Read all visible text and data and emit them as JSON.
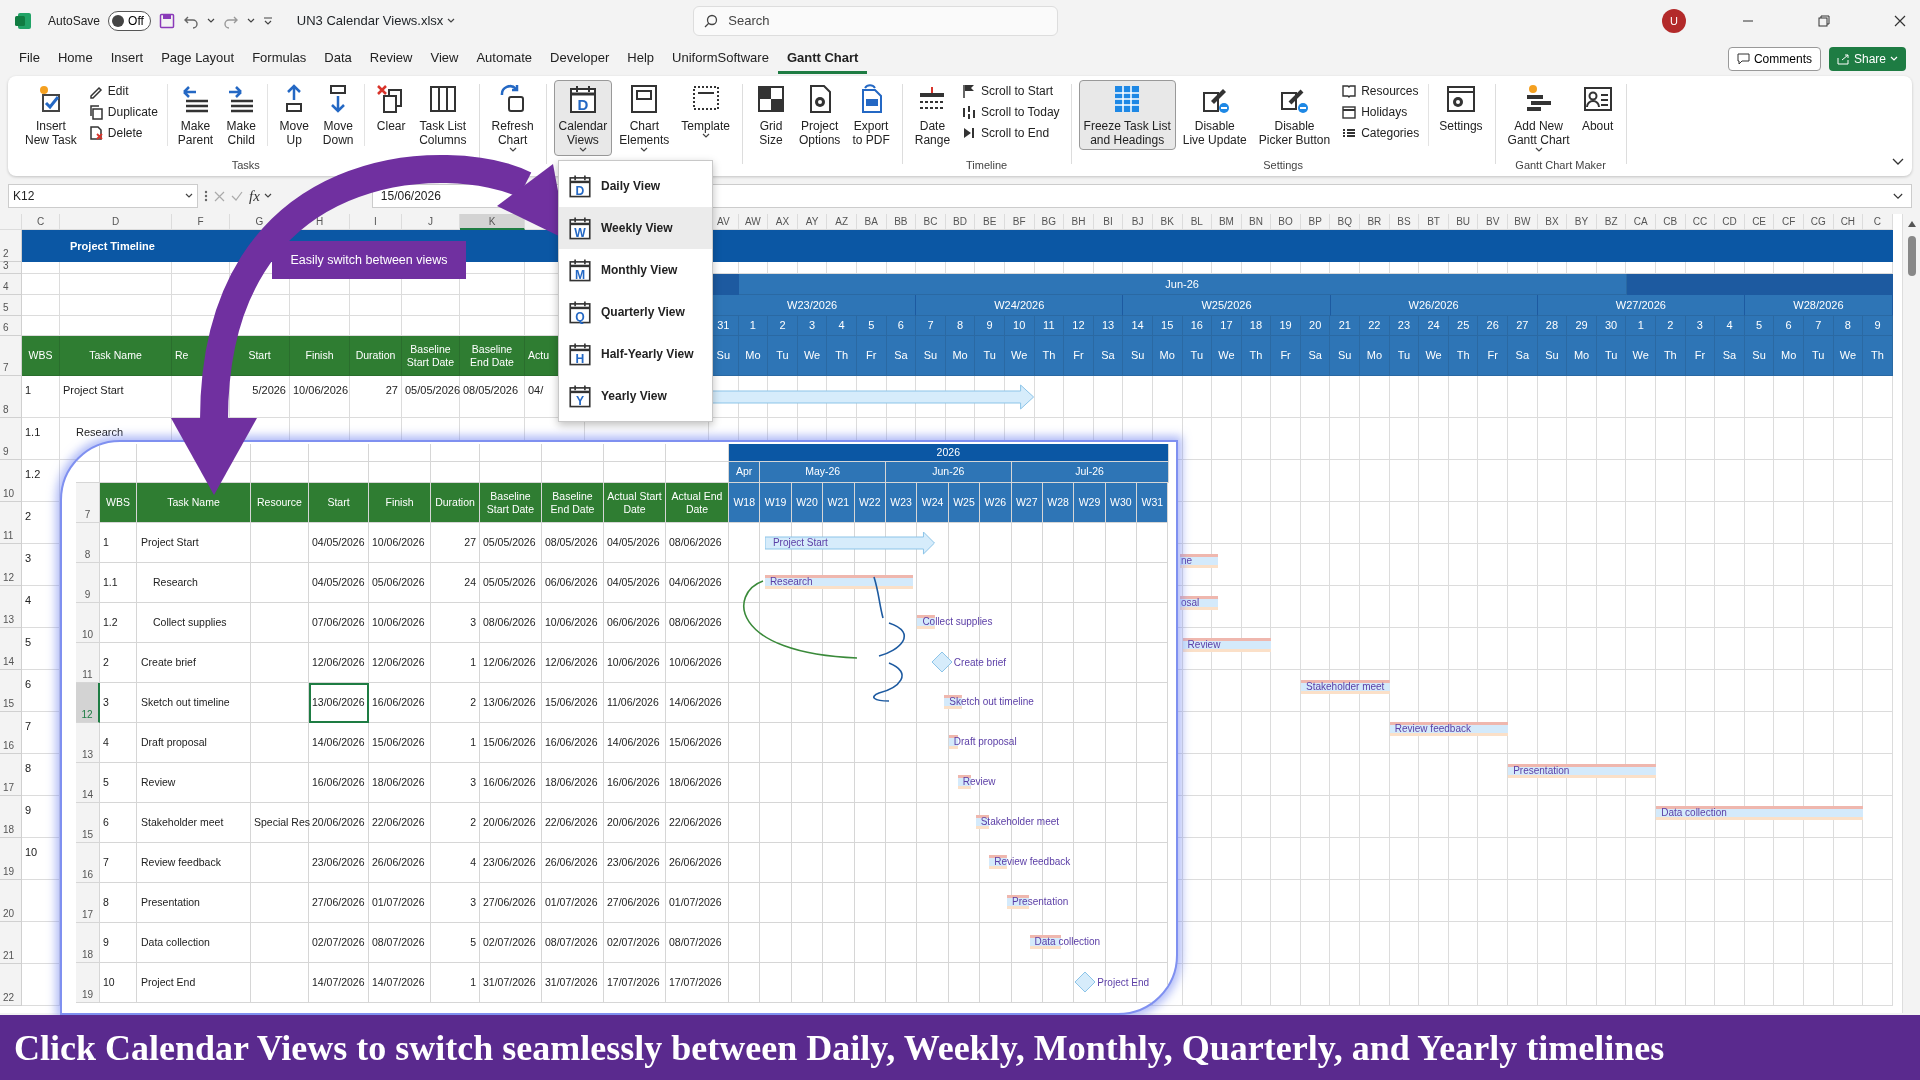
{
  "title_bar": {
    "autosave_label": "AutoSave",
    "autosave_state": "Off",
    "autosave_on": false,
    "file_name": "UN3 Calendar Views.xlsx",
    "search_placeholder": "Search",
    "user_initial": "U"
  },
  "menu": {
    "tabs": [
      {
        "label": "File",
        "selected": false
      },
      {
        "label": "Home",
        "selected": false
      },
      {
        "label": "Insert",
        "selected": false
      },
      {
        "label": "Page Layout",
        "selected": false
      },
      {
        "label": "Formulas",
        "selected": false
      },
      {
        "label": "Data",
        "selected": false
      },
      {
        "label": "Review",
        "selected": false
      },
      {
        "label": "View",
        "selected": false
      },
      {
        "label": "Automate",
        "selected": false
      },
      {
        "label": "Developer",
        "selected": false
      },
      {
        "label": "Help",
        "selected": false
      },
      {
        "label": "UniformSoftware",
        "selected": false
      },
      {
        "label": "Gantt Chart",
        "selected": true
      }
    ],
    "comments": "Comments",
    "share": "Share"
  },
  "ribbon": {
    "groups": [
      {
        "label": "Tasks",
        "items": [
          {
            "kind": "large",
            "lines": [
              "Insert",
              "New Task"
            ],
            "pressed": false,
            "dropdown": false
          },
          {
            "kind": "stack",
            "items": [
              {
                "label": "Edit"
              },
              {
                "label": "Duplicate"
              },
              {
                "label": "Delete"
              }
            ]
          },
          {
            "kind": "separator"
          },
          {
            "kind": "large",
            "lines": [
              "Make",
              "Parent"
            ],
            "pressed": false,
            "dropdown": false
          },
          {
            "kind": "large",
            "lines": [
              "Make",
              "Child"
            ],
            "pressed": false,
            "dropdown": false
          },
          {
            "kind": "separator"
          },
          {
            "kind": "large",
            "lines": [
              "Move",
              "Up"
            ],
            "pressed": false,
            "dropdown": false
          },
          {
            "kind": "large",
            "lines": [
              "Move",
              "Down"
            ],
            "pressed": false,
            "dropdown": false
          },
          {
            "kind": "separator"
          },
          {
            "kind": "large",
            "lines": [
              "Clear"
            ],
            "pressed": false,
            "dropdown": false
          },
          {
            "kind": "large",
            "lines": [
              "Task List",
              "Columns"
            ],
            "pressed": false,
            "dropdown": false
          }
        ]
      },
      {
        "items": [
          {
            "kind": "large",
            "lines": [
              "Refresh",
              "Chart"
            ],
            "pressed": false,
            "dropdown": true
          }
        ]
      },
      {
        "items": [
          {
            "kind": "large",
            "lines": [
              "Calendar",
              "Views"
            ],
            "pressed": true,
            "dropdown": true,
            "icon_letter": "D"
          },
          {
            "kind": "large",
            "lines": [
              "Chart",
              "Elements"
            ],
            "pressed": false,
            "dropdown": true
          },
          {
            "kind": "large",
            "lines": [
              "Template"
            ],
            "pressed": false,
            "dropdown": true
          }
        ]
      },
      {
        "items": [
          {
            "kind": "large",
            "lines": [
              "Grid",
              "Size"
            ],
            "pressed": false,
            "dropdown": false
          },
          {
            "kind": "large",
            "lines": [
              "Project",
              "Options"
            ],
            "pressed": false,
            "dropdown": false
          },
          {
            "kind": "large",
            "lines": [
              "Export",
              "to PDF"
            ],
            "pressed": false,
            "dropdown": false
          }
        ]
      },
      {
        "label": "Timeline",
        "items": [
          {
            "kind": "large",
            "lines": [
              "Date",
              "Range"
            ],
            "pressed": false,
            "dropdown": false
          },
          {
            "kind": "stack",
            "items": [
              {
                "label": "Scroll to Start"
              },
              {
                "label": "Scroll to Today"
              },
              {
                "label": "Scroll to End"
              }
            ]
          }
        ]
      },
      {
        "label": "Settings",
        "items": [
          {
            "kind": "large",
            "lines": [
              "Freeze Task List",
              "and Headings"
            ],
            "pressed": true,
            "dropdown": false
          },
          {
            "kind": "large",
            "lines": [
              "Disable",
              "Live Update"
            ],
            "pressed": false,
            "dropdown": false
          },
          {
            "kind": "large",
            "lines": [
              "Disable",
              "Picker Button"
            ],
            "pressed": false,
            "dropdown": false
          },
          {
            "kind": "stack",
            "items": [
              {
                "label": "Resources"
              },
              {
                "label": "Holidays"
              },
              {
                "label": "Categories"
              }
            ]
          },
          {
            "kind": "separator"
          },
          {
            "kind": "large",
            "lines": [
              "Settings"
            ],
            "pressed": false,
            "dropdown": false
          }
        ]
      },
      {
        "label": "Gantt Chart Maker",
        "items": [
          {
            "kind": "large",
            "lines": [
              "Add New",
              "Gantt Chart"
            ],
            "pressed": false,
            "dropdown": true
          },
          {
            "kind": "large",
            "lines": [
              "About"
            ],
            "pressed": false,
            "dropdown": false
          }
        ]
      }
    ]
  },
  "formula_bar": {
    "name_box": "K12",
    "function_label": "fx",
    "value": "15/06/2026"
  },
  "sheet": {
    "column_letters": [
      {
        "letter": "C",
        "selected": false
      },
      {
        "letter": "D",
        "selected": false
      },
      {
        "letter": "F",
        "selected": false
      },
      {
        "letter": "G",
        "selected": false
      },
      {
        "letter": "H",
        "selected": false
      },
      {
        "letter": "I",
        "selected": false
      },
      {
        "letter": "J",
        "selected": false
      },
      {
        "letter": "K",
        "selected": true
      }
    ],
    "calendar_letters": [
      "AV",
      "AW",
      "AX",
      "AY",
      "AZ",
      "BA",
      "BB",
      "BC",
      "BD",
      "BE",
      "BF",
      "BG",
      "BH",
      "BI",
      "BJ",
      "BK",
      "BL",
      "BM",
      "BN",
      "BO",
      "BP",
      "BQ",
      "BR",
      "BS",
      "BT",
      "BU",
      "BV",
      "BW",
      "BX",
      "BY",
      "BZ",
      "CA",
      "CB",
      "CC",
      "CD",
      "CE",
      "CF",
      "CG",
      "CH",
      "C"
    ],
    "row_numbers": [
      "2",
      "3",
      "4",
      "5",
      "6",
      "7",
      "8",
      "9",
      "10",
      "11",
      "12",
      "13",
      "14",
      "15",
      "16",
      "17",
      "18",
      "19",
      "20",
      "21",
      "22"
    ],
    "title": "Project Timeline",
    "calendar": {
      "months": [
        {
          "days": [
            {
              "date": "31",
              "weekday": "Su"
            }
          ]
        },
        {
          "label": "Jun-26",
          "days": [
            {
              "date": "1",
              "weekday": "Mo"
            },
            {
              "date": "2",
              "weekday": "Tu"
            },
            {
              "date": "3",
              "weekday": "We"
            },
            {
              "date": "4",
              "weekday": "Th"
            },
            {
              "date": "5",
              "weekday": "Fr"
            },
            {
              "date": "6",
              "weekday": "Sa"
            },
            {
              "date": "7",
              "weekday": "Su"
            },
            {
              "date": "8",
              "weekday": "Mo"
            },
            {
              "date": "9",
              "weekday": "Tu"
            },
            {
              "date": "10",
              "weekday": "We"
            },
            {
              "date": "11",
              "weekday": "Th"
            },
            {
              "date": "12",
              "weekday": "Fr"
            },
            {
              "date": "13",
              "weekday": "Sa"
            },
            {
              "date": "14",
              "weekday": "Su"
            },
            {
              "date": "15",
              "weekday": "Mo"
            },
            {
              "date": "16",
              "weekday": "Tu"
            },
            {
              "date": "17",
              "weekday": "We"
            },
            {
              "date": "18",
              "weekday": "Th"
            },
            {
              "date": "19",
              "weekday": "Fr"
            },
            {
              "date": "20",
              "weekday": "Sa"
            },
            {
              "date": "21",
              "weekday": "Su"
            },
            {
              "date": "22",
              "weekday": "Mo"
            },
            {
              "date": "23",
              "weekday": "Tu"
            },
            {
              "date": "24",
              "weekday": "We"
            },
            {
              "date": "25",
              "weekday": "Th"
            },
            {
              "date": "26",
              "weekday": "Fr"
            },
            {
              "date": "27",
              "weekday": "Sa"
            },
            {
              "date": "28",
              "weekday": "Su"
            },
            {
              "date": "29",
              "weekday": "Mo"
            },
            {
              "date": "30",
              "weekday": "Tu"
            }
          ]
        },
        {
          "days": [
            {
              "date": "1",
              "weekday": "We"
            },
            {
              "date": "2",
              "weekday": "Th"
            },
            {
              "date": "3",
              "weekday": "Fr"
            },
            {
              "date": "4",
              "weekday": "Sa"
            },
            {
              "date": "5",
              "weekday": "Su"
            },
            {
              "date": "6",
              "weekday": "Mo"
            },
            {
              "date": "7",
              "weekday": "Tu"
            },
            {
              "date": "8",
              "weekday": "We"
            },
            {
              "date": "9",
              "weekday": "Th"
            }
          ]
        }
      ],
      "weeks": [
        {
          "label": "W23/2026"
        },
        {
          "label": "W24/2026"
        },
        {
          "label": "W25/2026"
        },
        {
          "label": "W26/2026"
        },
        {
          "label": "W27/2026"
        },
        {
          "label": "W28/2026"
        }
      ]
    },
    "header": [
      "WBS",
      "Task Name",
      "Re",
      "Start",
      "Finish",
      "Duration",
      "Baseline Start Date",
      "Baseline End Date",
      "Actu"
    ],
    "rows": [
      {
        "wbs": "1",
        "task": "Project Start",
        "start": "5/2026",
        "finish": "10/06/2026",
        "duration": "27",
        "baseline_start": "05/05/2026",
        "baseline_end": "08/05/2026",
        "actual_start": "04/",
        "bar": {
          "kind": "arrow"
        }
      },
      {
        "wbs": "1.1",
        "task": "Research"
      },
      {
        "wbs": "1.2"
      },
      {
        "wbs": "2"
      },
      {
        "wbs": "3",
        "bar": {
          "kind": "task",
          "label": "ne"
        }
      },
      {
        "wbs": "4",
        "bar": {
          "kind": "task",
          "label": "osal"
        }
      },
      {
        "wbs": "5",
        "bar": {
          "kind": "task",
          "label": "Review"
        }
      },
      {
        "wbs": "6",
        "bar": {
          "kind": "task",
          "label": "Stakeholder meet"
        }
      },
      {
        "wbs": "7",
        "bar": {
          "kind": "task",
          "label": "Review feedback"
        }
      },
      {
        "wbs": "8",
        "bar": {
          "kind": "task",
          "label": "Presentation"
        }
      },
      {
        "wbs": "9",
        "bar": {
          "kind": "task",
          "label": "Data collection"
        }
      },
      {
        "wbs": "10"
      }
    ]
  },
  "views_menu": {
    "items": [
      {
        "label": "Daily View",
        "icon_letter": "D",
        "selected": false
      },
      {
        "label": "Weekly View",
        "icon_letter": "W",
        "selected": true
      },
      {
        "label": "Monthly View",
        "icon_letter": "M",
        "selected": false
      },
      {
        "label": "Quarterly View",
        "icon_letter": "Q",
        "selected": false
      },
      {
        "label": "Half-Yearly View",
        "icon_letter": "H",
        "selected": false
      },
      {
        "label": "Yearly View",
        "icon_letter": "Y",
        "selected": false
      }
    ]
  },
  "callout": "Easily switch between views",
  "inset": {
    "header_row_number": "7",
    "year": "2026",
    "months": [
      {
        "label": "Apr",
        "weeks": [
          "W18"
        ]
      },
      {
        "label": "May-26",
        "weeks": [
          "W19",
          "W20",
          "W21",
          "W22"
        ]
      },
      {
        "label": "Jun-26",
        "weeks": [
          "W23",
          "W24",
          "W25",
          "W26"
        ]
      },
      {
        "label": "Jul-26",
        "weeks": [
          "W27",
          "W28",
          "W29",
          "W30",
          "W31"
        ]
      }
    ],
    "columns": [
      "WBS",
      "Task Name",
      "Resource",
      "Start",
      "Finish",
      "Duration",
      "Baseline Start Date",
      "Baseline End Date",
      "Actual Start Date",
      "Actual End Date"
    ],
    "row_numbers": [
      "8",
      "9",
      "10",
      "11",
      "12",
      "13",
      "14",
      "15",
      "16",
      "17",
      "18",
      "19"
    ],
    "rows": [
      {
        "wbs": "1",
        "task": "Project Start",
        "bar_label": "Project Start",
        "start": "04/05/2026",
        "finish": "10/06/2026",
        "duration": "27",
        "baseline_start": "05/05/2026",
        "baseline_end": "08/05/2026",
        "actual_start": "04/05/2026",
        "actual_end": "08/06/2026",
        "kind": "summary",
        "active_cell": false,
        "children": [
          {
            "wbs": "1.1",
            "task": "Research",
            "bar_label": "Research",
            "start": "04/05/2026",
            "finish": "05/06/2026",
            "duration": "24",
            "baseline_start": "05/05/2026",
            "baseline_end": "06/06/2026",
            "actual_start": "04/05/2026",
            "actual_end": "04/06/2026",
            "kind": "task",
            "active_cell": false
          },
          {
            "wbs": "1.2",
            "task": "Collect supplies",
            "bar_label": "Collect supplies",
            "start": "07/06/2026",
            "finish": "10/06/2026",
            "duration": "3",
            "baseline_start": "08/06/2026",
            "baseline_end": "10/06/2026",
            "actual_start": "06/06/2026",
            "actual_end": "08/06/2026",
            "kind": "task",
            "active_cell": false
          }
        ]
      },
      {
        "wbs": "2",
        "task": "Create brief",
        "bar_label": "Create brief",
        "start": "12/06/2026",
        "finish": "12/06/2026",
        "duration": "1",
        "baseline_start": "12/06/2026",
        "baseline_end": "12/06/2026",
        "actual_start": "10/06/2026",
        "actual_end": "10/06/2026",
        "kind": "milestone",
        "active_cell": false
      },
      {
        "wbs": "3",
        "task": "Sketch out timeline",
        "bar_label": "Sketch out timeline",
        "start": "13/06/2026",
        "finish": "16/06/2026",
        "duration": "2",
        "baseline_start": "13/06/2026",
        "baseline_end": "15/06/2026",
        "actual_start": "11/06/2026",
        "actual_end": "14/06/2026",
        "kind": "task",
        "active_cell": true
      },
      {
        "wbs": "4",
        "task": "Draft proposal",
        "bar_label": "Draft proposal",
        "start": "14/06/2026",
        "finish": "15/06/2026",
        "duration": "1",
        "baseline_start": "15/06/2026",
        "baseline_end": "16/06/2026",
        "actual_start": "14/06/2026",
        "actual_end": "15/06/2026",
        "kind": "task",
        "active_cell": false
      },
      {
        "wbs": "5",
        "task": "Review",
        "bar_label": "Review",
        "start": "16/06/2026",
        "finish": "18/06/2026",
        "duration": "3",
        "baseline_start": "16/06/2026",
        "baseline_end": "18/06/2026",
        "actual_start": "16/06/2026",
        "actual_end": "18/06/2026",
        "kind": "task",
        "active_cell": false
      },
      {
        "wbs": "6",
        "task": "Stakeholder meet",
        "bar_label": "Stakeholder meet",
        "resource": "Special Res",
        "start": "20/06/2026",
        "finish": "22/06/2026",
        "duration": "2",
        "baseline_start": "20/06/2026",
        "baseline_end": "22/06/2026",
        "actual_start": "20/06/2026",
        "actual_end": "22/06/2026",
        "kind": "task",
        "active_cell": false
      },
      {
        "wbs": "7",
        "task": "Review feedback",
        "bar_label": "Review feedback",
        "start": "23/06/2026",
        "finish": "26/06/2026",
        "duration": "4",
        "baseline_start": "23/06/2026",
        "baseline_end": "26/06/2026",
        "actual_start": "23/06/2026",
        "actual_end": "26/06/2026",
        "kind": "task",
        "active_cell": false
      },
      {
        "wbs": "8",
        "task": "Presentation",
        "bar_label": "Presentation",
        "start": "27/06/2026",
        "finish": "01/07/2026",
        "duration": "3",
        "baseline_start": "27/06/2026",
        "baseline_end": "01/07/2026",
        "actual_start": "27/06/2026",
        "actual_end": "01/07/2026",
        "kind": "task",
        "active_cell": false
      },
      {
        "wbs": "9",
        "task": "Data collection",
        "bar_label": "Data collection",
        "start": "02/07/2026",
        "finish": "08/07/2026",
        "duration": "5",
        "baseline_start": "02/07/2026",
        "baseline_end": "08/07/2026",
        "actual_start": "02/07/2026",
        "actual_end": "08/07/2026",
        "kind": "task",
        "active_cell": false
      },
      {
        "wbs": "10",
        "task": "Project End",
        "bar_label": "Project End",
        "start": "14/07/2026",
        "finish": "14/07/2026",
        "duration": "1",
        "baseline_start": "31/07/2026",
        "baseline_end": "31/07/2026",
        "actual_start": "17/07/2026",
        "actual_end": "17/07/2026",
        "kind": "milestone",
        "active_cell": false
      }
    ]
  },
  "caption": "Click Calendar Views to switch seamlessly between Daily, Weekly, Monthly, Quarterly, and Yearly timelines"
}
